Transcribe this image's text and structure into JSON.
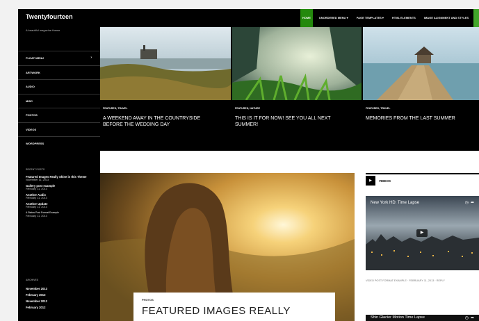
{
  "site": {
    "title": "Twentyfourteen",
    "tagline": "A beautiful magazine theme"
  },
  "nav": {
    "items": [
      {
        "label": "Home",
        "active": true
      },
      {
        "label": "Unordered Menu ▾",
        "active": false
      },
      {
        "label": "Page Templates ▾",
        "active": false
      },
      {
        "label": "HTML Elements",
        "active": false
      },
      {
        "label": "Image Alignment and Styles",
        "active": false
      }
    ],
    "accent_color": "#24890d"
  },
  "sidebar": {
    "menu": [
      {
        "label": "Float Menu",
        "has_children": true
      },
      {
        "label": "Artwork"
      },
      {
        "label": "Audio"
      },
      {
        "label": "Misc"
      },
      {
        "label": "Photos"
      },
      {
        "label": "Videos"
      },
      {
        "label": "Wordpress"
      }
    ],
    "recent_posts_title": "Recent Posts",
    "recent_posts": [
      {
        "title": "Featured Images Really Shine in this Theme",
        "date": "November 11, 2013"
      },
      {
        "title": "Gallery post example",
        "date": "February 11, 2013"
      },
      {
        "title": "Another Audio",
        "date": "February 11, 2013"
      },
      {
        "title": "Another Update",
        "date": "February 11, 2013"
      },
      {
        "title": "A Status Post Format Example",
        "date": "February 11, 2013"
      }
    ],
    "archives_title": "Archives",
    "archives": [
      "November 2013",
      "February 2013",
      "November 2012",
      "February 2012"
    ]
  },
  "featured": [
    {
      "category": "Featured, Travel",
      "title": "A weekend away in the countryside before the wedding day"
    },
    {
      "category": "Featured, Nature",
      "title": "This is it for now! See you all next summer!"
    },
    {
      "category": "Featured, Travel",
      "title": "Memories from the last summer"
    }
  ],
  "main_post": {
    "category": "Photos",
    "title": "Featured Images Really"
  },
  "videos_widget": {
    "label": "Videos",
    "video_title": "New York HD: Time Lapse",
    "meta": "Video post format example · February 11, 2013 · Reply",
    "video2_title": "Shin Glacier Motion Time Lapse"
  }
}
